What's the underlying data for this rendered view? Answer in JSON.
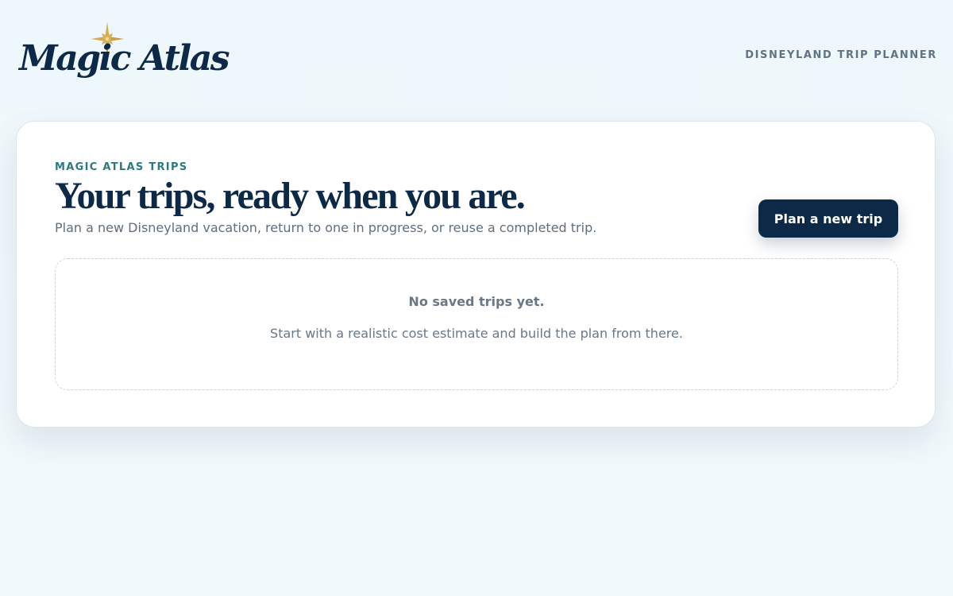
{
  "header": {
    "logo_text": "Magic Atlas",
    "tagline": "DISNEYLAND TRIP PLANNER"
  },
  "main": {
    "eyebrow": "MAGIC ATLAS TRIPS",
    "title": "Your trips, ready when you are.",
    "subtitle": "Plan a new Disneyland vacation, return to one in progress, or reuse a completed trip.",
    "primary_button_label": "Plan a new trip",
    "empty_state": {
      "title": "No saved trips yet.",
      "text": "Start with a realistic cost estimate and build the plan from there."
    }
  },
  "colors": {
    "brand_navy": "#0c2a47",
    "accent_teal": "#2b7a7f",
    "star_gold": "#c9a24a",
    "background": "#eef7fb"
  },
  "icons": {
    "logo_star": "compass-star-icon"
  }
}
